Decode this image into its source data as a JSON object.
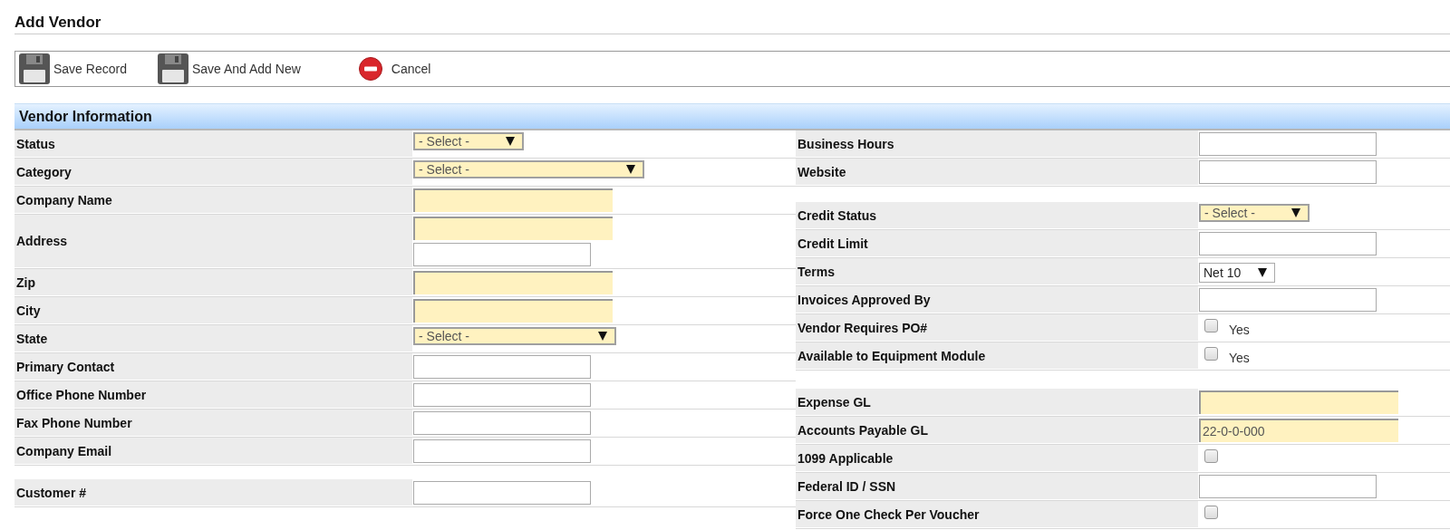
{
  "title": "Add Vendor",
  "toolbar": [
    {
      "kind": "save",
      "label": "Save Record"
    },
    {
      "kind": "save",
      "label": "Save And Add New"
    },
    {
      "kind": "cancel",
      "label": "Cancel"
    }
  ],
  "section": {
    "title": "Vendor Information"
  },
  "left": [
    {
      "rows": [
        {
          "label": "Status",
          "fields": [
            {
              "kind": "select",
              "value": "- Select -",
              "required": true
            }
          ]
        },
        {
          "label": "Category",
          "fields": [
            {
              "kind": "select",
              "value": "- Select -",
              "required": true
            }
          ]
        },
        {
          "label": "Company Name",
          "fields": [
            {
              "kind": "text",
              "required": true
            }
          ]
        },
        {
          "label": "Address",
          "fields": [
            {
              "kind": "text",
              "required": true
            },
            {
              "kind": "text",
              "required": false
            }
          ]
        },
        {
          "label": "Zip",
          "fields": [
            {
              "kind": "text",
              "required": true
            }
          ]
        },
        {
          "label": "City",
          "fields": [
            {
              "kind": "text",
              "required": true
            }
          ]
        },
        {
          "label": "State",
          "fields": [
            {
              "kind": "select",
              "value": "- Select -",
              "required": true
            }
          ]
        },
        {
          "label": "Primary Contact",
          "fields": [
            {
              "kind": "text",
              "required": false
            }
          ]
        },
        {
          "label": "Office Phone Number",
          "fields": [
            {
              "kind": "text",
              "required": false
            }
          ]
        },
        {
          "label": "Fax Phone Number",
          "fields": [
            {
              "kind": "text",
              "required": false
            }
          ]
        },
        {
          "label": "Company Email",
          "fields": [
            {
              "kind": "text",
              "required": false
            }
          ]
        }
      ]
    },
    {
      "rows": [
        {
          "label": "Customer #",
          "fields": [
            {
              "kind": "text",
              "required": false
            }
          ]
        }
      ]
    }
  ],
  "right": [
    {
      "rows": [
        {
          "label": "Business Hours",
          "fields": [
            {
              "kind": "text",
              "required": false
            }
          ]
        },
        {
          "label": "Website",
          "fields": [
            {
              "kind": "text",
              "required": false
            }
          ]
        }
      ]
    },
    {
      "rows": [
        {
          "label": "Credit Status",
          "fields": [
            {
              "kind": "select",
              "value": "- Select -",
              "required": true
            }
          ]
        },
        {
          "label": "Credit Limit",
          "fields": [
            {
              "kind": "text",
              "required": false
            }
          ]
        },
        {
          "label": "Terms",
          "fields": [
            {
              "kind": "select",
              "value": "Net 10",
              "required": false
            }
          ]
        },
        {
          "label": "Invoices Approved By",
          "fields": [
            {
              "kind": "text",
              "required": false
            }
          ]
        },
        {
          "label": "Vendor Requires PO#",
          "fields": [
            {
              "kind": "checkbox",
              "checked": false,
              "text": "Yes"
            }
          ]
        },
        {
          "label": "Available to Equipment Module",
          "fields": [
            {
              "kind": "checkbox",
              "checked": false,
              "text": "Yes"
            }
          ]
        }
      ]
    },
    {
      "rows": [
        {
          "label": "Expense GL",
          "fields": [
            {
              "kind": "text",
              "required": true
            }
          ]
        },
        {
          "label": "Accounts Payable GL",
          "fields": [
            {
              "kind": "text",
              "required": true,
              "value": "22-0-0-000"
            }
          ]
        },
        {
          "label": "1099 Applicable",
          "fields": [
            {
              "kind": "checkbox",
              "checked": false
            }
          ]
        },
        {
          "label": "Federal ID / SSN",
          "fields": [
            {
              "kind": "text",
              "required": false
            }
          ]
        },
        {
          "label": "Force One Check Per Voucher",
          "fields": [
            {
              "kind": "checkbox",
              "checked": false
            }
          ]
        }
      ]
    }
  ]
}
